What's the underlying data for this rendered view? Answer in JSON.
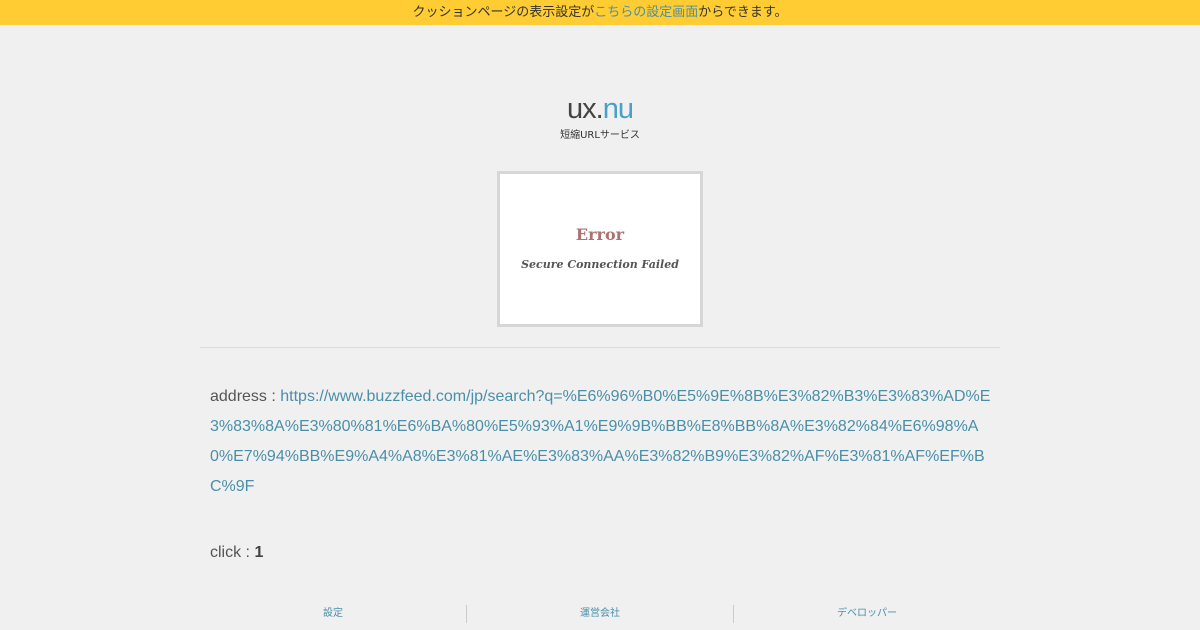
{
  "notice": {
    "prefix": "クッションページの表示設定が",
    "link_label": "こちらの設定画面",
    "suffix": "からできます。"
  },
  "logo": {
    "ux": "ux",
    "dot": ".",
    "nu": "nu",
    "subtitle": "短縮URLサービス"
  },
  "thumbnail": {
    "error_title": "Error",
    "error_message": "Secure Connection Failed"
  },
  "info": {
    "address_label": "address : ",
    "address_url": "https://www.buzzfeed.com/jp/search?q=%E6%96%B0%E5%9E%8B%E3%82%B3%E3%83%AD%E3%83%8A%E3%80%81%E6%BA%80%E5%93%A1%E9%9B%BB%E8%BB%8A%E3%82%84%E6%98%A0%E7%94%BB%E9%A4%A8%E3%81%AE%E3%83%AA%E3%82%B9%E3%82%AF%E3%81%AF%EF%BC%9F",
    "click_label": "click : ",
    "click_count": "1"
  },
  "footer": {
    "items": [
      {
        "label": "設定"
      },
      {
        "label": "運営会社"
      },
      {
        "label": "デベロッパー"
      }
    ]
  },
  "colors": {
    "notice_bg": "#ffcc33",
    "link": "#4a8fa8",
    "logo_accent": "#4aa0c8",
    "error_title": "#b07070"
  }
}
